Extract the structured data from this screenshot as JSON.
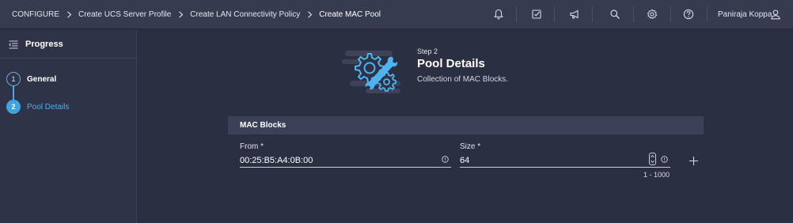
{
  "breadcrumb": {
    "items": [
      "CONFIGURE",
      "Create UCS Server Profile",
      "Create LAN Connectivity Policy",
      "Create MAC Pool"
    ]
  },
  "topbar": {
    "icons": [
      "bell-icon",
      "checklist-icon",
      "megaphone-icon",
      "search-icon",
      "gear-icon",
      "help-icon"
    ],
    "user_name": "Paniraja Koppa"
  },
  "sidebar": {
    "title": "Progress",
    "steps": [
      {
        "number": "1",
        "label": "General",
        "state": "done"
      },
      {
        "number": "2",
        "label": "Pool Details",
        "state": "active"
      }
    ]
  },
  "header": {
    "kicker": "Step 2",
    "title": "Pool Details",
    "subtitle": "Collection of MAC Blocks."
  },
  "mac_blocks": {
    "section_title": "MAC Blocks",
    "from_label": "From *",
    "from_value": "00:25:B5:A4:0B:00",
    "size_label": "Size *",
    "size_value": "64",
    "size_range": "1 - 1000"
  },
  "colors": {
    "background": "#2b2f42",
    "topbar": "#363b50",
    "accent": "#3ea3e2",
    "section_bar": "#3c4158"
  }
}
